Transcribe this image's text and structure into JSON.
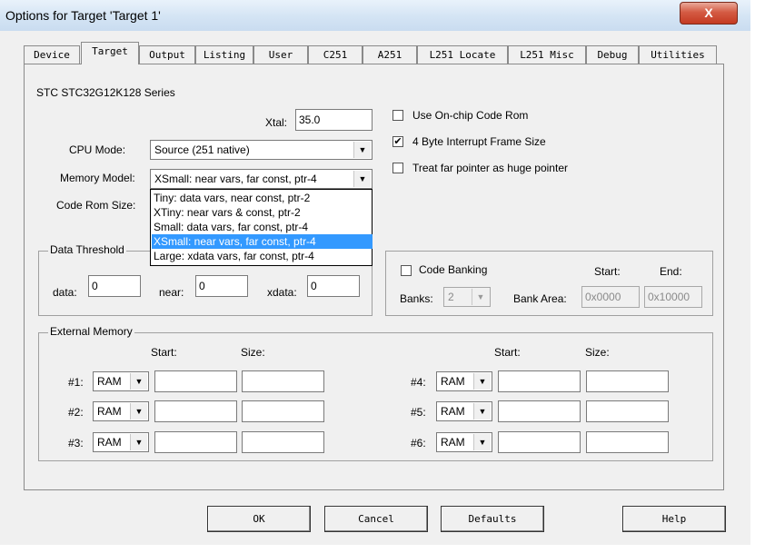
{
  "window": {
    "title": "Options for Target 'Target 1'",
    "close_label": "X"
  },
  "tabs": [
    {
      "label": "Device"
    },
    {
      "label": "Target"
    },
    {
      "label": "Output"
    },
    {
      "label": "Listing"
    },
    {
      "label": "User"
    },
    {
      "label": "C251"
    },
    {
      "label": "A251"
    },
    {
      "label": "L251 Locate"
    },
    {
      "label": "L251 Misc"
    },
    {
      "label": "Debug"
    },
    {
      "label": "Utilities"
    }
  ],
  "target": {
    "series": "STC STC32G12K128 Series",
    "xtal_label": "Xtal:",
    "xtal_value": "35.0",
    "cpu_mode_label": "CPU Mode:",
    "cpu_mode_value": "Source (251 native)",
    "memory_model_label": "Memory Model:",
    "memory_model_value": "XSmall: near vars, far const, ptr-4",
    "code_rom_size_label": "Code Rom Size:",
    "memory_model_options": [
      "Tiny: data vars, near const, ptr-2",
      "XTiny: near vars & const, ptr-2",
      "Small: data vars, far const, ptr-4",
      "XSmall: near vars, far const, ptr-4",
      "Large: xdata vars, far const, ptr-4"
    ],
    "options": [
      {
        "label": "Use On-chip Code Rom",
        "checked": false
      },
      {
        "label": "4 Byte Interrupt Frame Size",
        "checked": true
      },
      {
        "label": "Treat far pointer as huge pointer",
        "checked": false
      }
    ]
  },
  "data_threshold": {
    "title": "Data Threshold",
    "data_label": "data:",
    "data_value": "0",
    "near_label": "near:",
    "near_value": "0",
    "xdata_label": "xdata:",
    "xdata_value": "0"
  },
  "code_banking": {
    "label": "Code Banking",
    "checked": false,
    "start_header": "Start:",
    "end_header": "End:",
    "banks_label": "Banks:",
    "banks_value": "2",
    "bank_area_label": "Bank Area:",
    "bank_area_start": "0x0000",
    "bank_area_end": "0x10000"
  },
  "external_memory": {
    "title": "External Memory",
    "start_header": "Start:",
    "size_header": "Size:",
    "rows": [
      {
        "label": "#1:",
        "type": "RAM",
        "start": "",
        "size": ""
      },
      {
        "label": "#2:",
        "type": "RAM",
        "start": "",
        "size": ""
      },
      {
        "label": "#3:",
        "type": "RAM",
        "start": "",
        "size": ""
      },
      {
        "label": "#4:",
        "type": "RAM",
        "start": "",
        "size": ""
      },
      {
        "label": "#5:",
        "type": "RAM",
        "start": "",
        "size": ""
      },
      {
        "label": "#6:",
        "type": "RAM",
        "start": "",
        "size": ""
      }
    ]
  },
  "buttons": {
    "ok": "OK",
    "cancel": "Cancel",
    "defaults": "Defaults",
    "help": "Help"
  },
  "icons": {
    "dropdown": "chevron-down-icon",
    "checkmark": "checkmark-icon",
    "close": "close-icon"
  },
  "colors": {
    "selection": "#3399ff",
    "window_bg": "#f0f0f0",
    "close_button": "#c43a22"
  }
}
